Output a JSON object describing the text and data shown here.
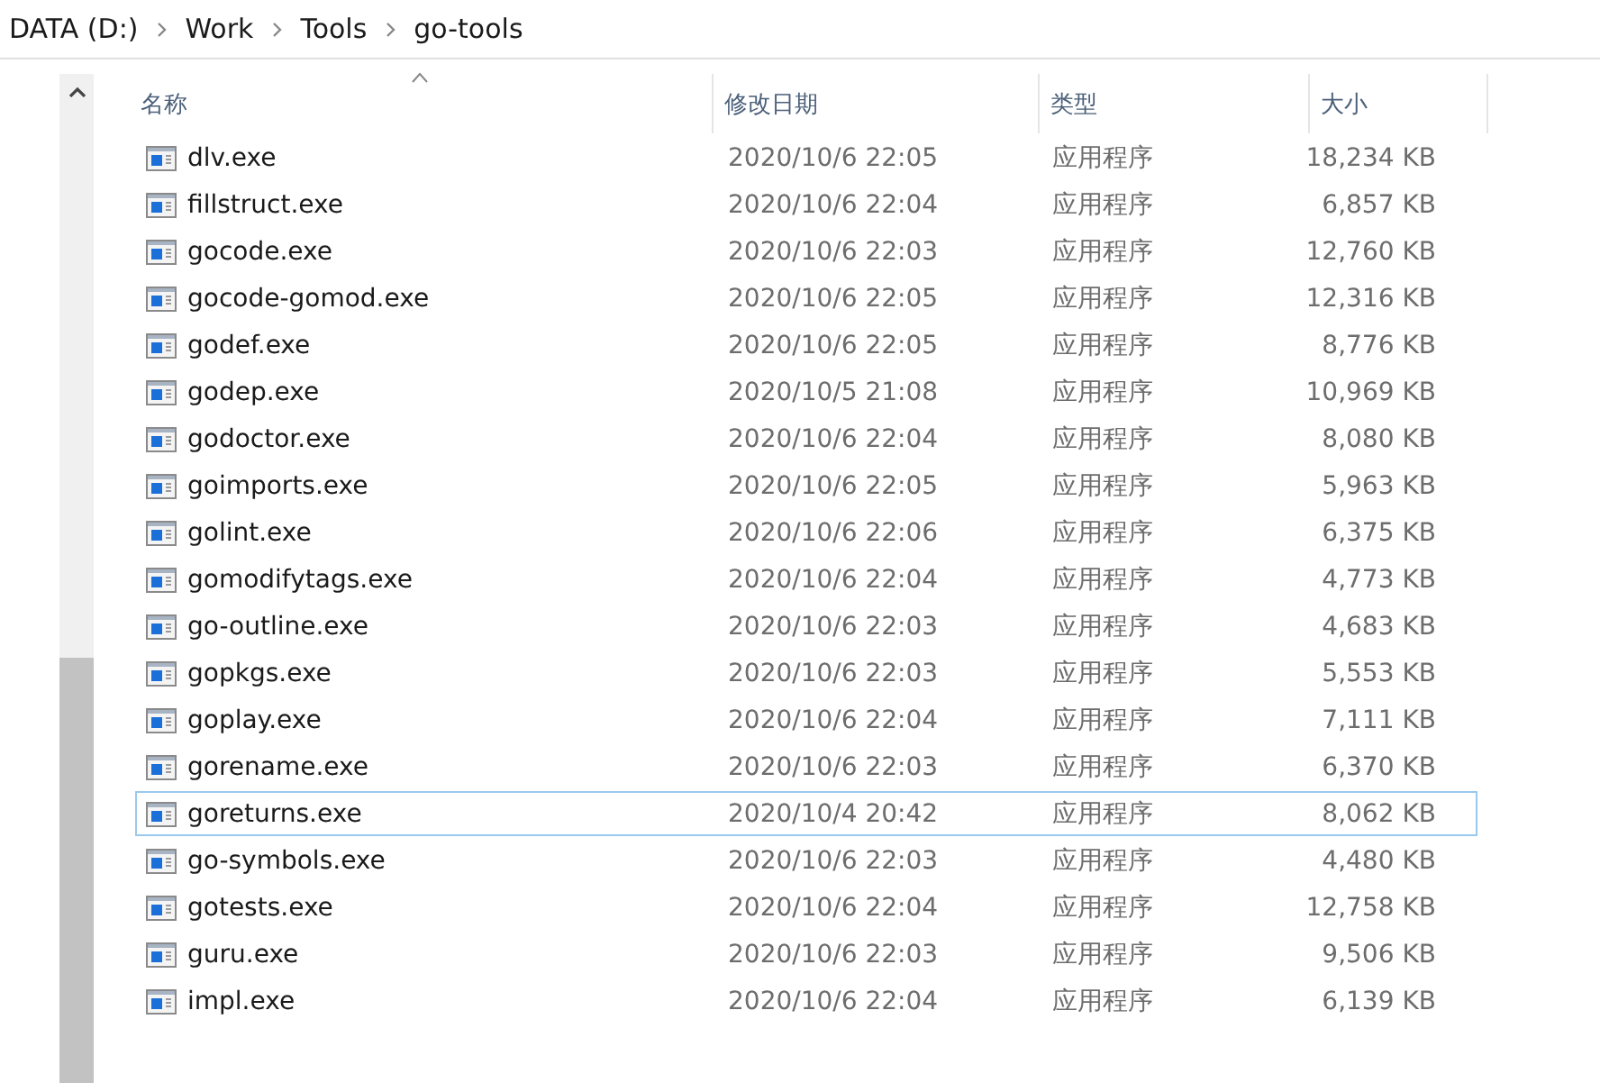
{
  "breadcrumb": [
    "DATA (D:)",
    "Work",
    "Tools",
    "go-tools"
  ],
  "table": {
    "columns": [
      "名称",
      "修改日期",
      "类型",
      "大小"
    ],
    "rows": [
      {
        "name": "dlv.exe",
        "modified": "2020/10/6 22:05",
        "type": "应用程序",
        "size": "18,234 KB",
        "focused": false
      },
      {
        "name": "fillstruct.exe",
        "modified": "2020/10/6 22:04",
        "type": "应用程序",
        "size": "6,857 KB",
        "focused": false
      },
      {
        "name": "gocode.exe",
        "modified": "2020/10/6 22:03",
        "type": "应用程序",
        "size": "12,760 KB",
        "focused": false
      },
      {
        "name": "gocode-gomod.exe",
        "modified": "2020/10/6 22:05",
        "type": "应用程序",
        "size": "12,316 KB",
        "focused": false
      },
      {
        "name": "godef.exe",
        "modified": "2020/10/6 22:05",
        "type": "应用程序",
        "size": "8,776 KB",
        "focused": false
      },
      {
        "name": "godep.exe",
        "modified": "2020/10/5 21:08",
        "type": "应用程序",
        "size": "10,969 KB",
        "focused": false
      },
      {
        "name": "godoctor.exe",
        "modified": "2020/10/6 22:04",
        "type": "应用程序",
        "size": "8,080 KB",
        "focused": false
      },
      {
        "name": "goimports.exe",
        "modified": "2020/10/6 22:05",
        "type": "应用程序",
        "size": "5,963 KB",
        "focused": false
      },
      {
        "name": "golint.exe",
        "modified": "2020/10/6 22:06",
        "type": "应用程序",
        "size": "6,375 KB",
        "focused": false
      },
      {
        "name": "gomodifytags.exe",
        "modified": "2020/10/6 22:04",
        "type": "应用程序",
        "size": "4,773 KB",
        "focused": false
      },
      {
        "name": "go-outline.exe",
        "modified": "2020/10/6 22:03",
        "type": "应用程序",
        "size": "4,683 KB",
        "focused": false
      },
      {
        "name": "gopkgs.exe",
        "modified": "2020/10/6 22:03",
        "type": "应用程序",
        "size": "5,553 KB",
        "focused": false
      },
      {
        "name": "goplay.exe",
        "modified": "2020/10/6 22:04",
        "type": "应用程序",
        "size": "7,111 KB",
        "focused": false
      },
      {
        "name": "gorename.exe",
        "modified": "2020/10/6 22:03",
        "type": "应用程序",
        "size": "6,370 KB",
        "focused": false
      },
      {
        "name": "goreturns.exe",
        "modified": "2020/10/4 20:42",
        "type": "应用程序",
        "size": "8,062 KB",
        "focused": true
      },
      {
        "name": "go-symbols.exe",
        "modified": "2020/10/6 22:03",
        "type": "应用程序",
        "size": "4,480 KB",
        "focused": false
      },
      {
        "name": "gotests.exe",
        "modified": "2020/10/6 22:04",
        "type": "应用程序",
        "size": "12,758 KB",
        "focused": false
      },
      {
        "name": "guru.exe",
        "modified": "2020/10/6 22:03",
        "type": "应用程序",
        "size": "9,506 KB",
        "focused": false
      },
      {
        "name": "impl.exe",
        "modified": "2020/10/6 22:04",
        "type": "应用程序",
        "size": "6,139 KB",
        "focused": false
      }
    ]
  }
}
